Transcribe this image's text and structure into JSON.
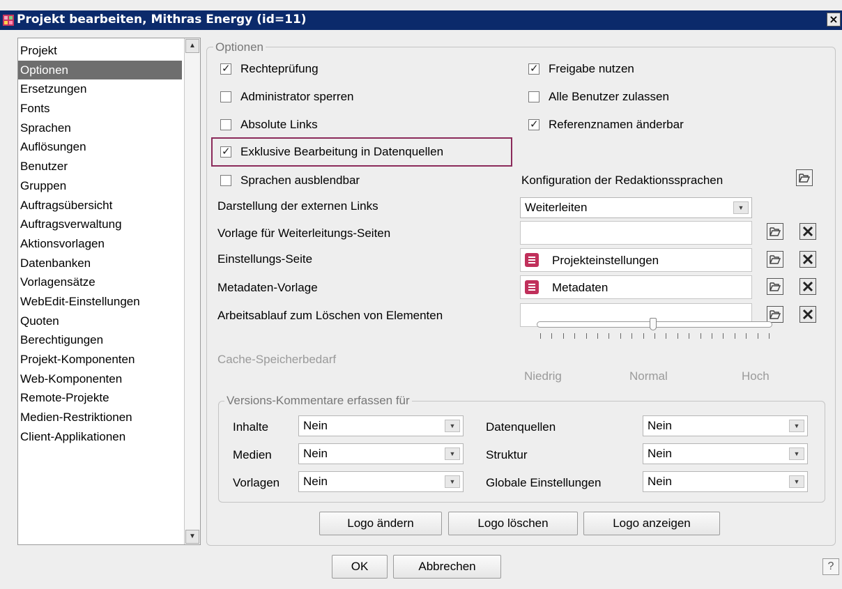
{
  "window": {
    "title": "Projekt bearbeiten, Mithras Energy (id=11)",
    "close_label": "×",
    "help_label": "?"
  },
  "sidebar": {
    "items": [
      {
        "label": "Projekt"
      },
      {
        "label": "Optionen",
        "selected": true
      },
      {
        "label": "Ersetzungen"
      },
      {
        "label": "Fonts"
      },
      {
        "label": "Sprachen"
      },
      {
        "label": "Auflösungen"
      },
      {
        "label": "Benutzer"
      },
      {
        "label": "Gruppen"
      },
      {
        "label": "Auftragsübersicht"
      },
      {
        "label": "Auftragsverwaltung"
      },
      {
        "label": "Aktionsvorlagen"
      },
      {
        "label": "Datenbanken"
      },
      {
        "label": "Vorlagensätze"
      },
      {
        "label": "WebEdit-Einstellungen"
      },
      {
        "label": "Quoten"
      },
      {
        "label": "Berechtigungen"
      },
      {
        "label": "Projekt-Komponenten"
      },
      {
        "label": "Web-Komponenten"
      },
      {
        "label": "Remote-Projekte"
      },
      {
        "label": "Medien-Restriktionen"
      },
      {
        "label": "Client-Applikationen"
      }
    ]
  },
  "options": {
    "legend": "Optionen",
    "checkboxes": {
      "rechtepruefung": {
        "label": "Rechteprüfung",
        "checked": true
      },
      "freigabe": {
        "label": "Freigabe nutzen",
        "checked": true
      },
      "admin_sperren": {
        "label": "Administrator sperren",
        "checked": false
      },
      "alle_benutzer": {
        "label": "Alle Benutzer zulassen",
        "checked": false
      },
      "absolute_links": {
        "label": "Absolute Links",
        "checked": false
      },
      "referenznamen": {
        "label": "Referenznamen änderbar",
        "checked": true
      },
      "exklusive": {
        "label": "Exklusive Bearbeitung in Datenquellen",
        "checked": true
      },
      "sprachen_ausblendbar": {
        "label": "Sprachen ausblendbar",
        "checked": false
      }
    },
    "konfiguration_label": "Konfiguration der Redaktionssprachen",
    "darstellung_label": "Darstellung der externen Links",
    "darstellung_value": "Weiterleiten",
    "vorlage_label": "Vorlage für Weiterleitungs-Seiten",
    "vorlage_value": "",
    "einstellung_label": "Einstellungs-Seite",
    "einstellung_value": "Projekteinstellungen",
    "metadaten_label": "Metadaten-Vorlage",
    "metadaten_value": "Metadaten",
    "arbeitsablauf_label": "Arbeitsablauf zum Löschen von Elementen",
    "arbeitsablauf_value": "",
    "cache_label": "Cache-Speicherbedarf",
    "cache_min": "Niedrig",
    "cache_mid": "Normal",
    "cache_max": "Hoch",
    "cache_level": 0.5
  },
  "versions": {
    "legend": "Versions-Kommentare erfassen für",
    "inhalte_label": "Inhalte",
    "inhalte_value": "Nein",
    "medien_label": "Medien",
    "medien_value": "Nein",
    "vorlagen_label": "Vorlagen",
    "vorlagen_value": "Nein",
    "datenquellen_label": "Datenquellen",
    "datenquellen_value": "Nein",
    "struktur_label": "Struktur",
    "struktur_value": "Nein",
    "globale_label": "Globale Einstellungen",
    "globale_value": "Nein"
  },
  "logo": {
    "aendern": "Logo ändern",
    "loeschen": "Logo löschen",
    "anzeigen": "Logo anzeigen"
  },
  "footer": {
    "ok": "OK",
    "abbrechen": "Abbrechen"
  },
  "icons": {
    "app": "app-icon",
    "open": "folder-open-icon",
    "delete": "delete-x-icon",
    "doc": "document-icon"
  }
}
